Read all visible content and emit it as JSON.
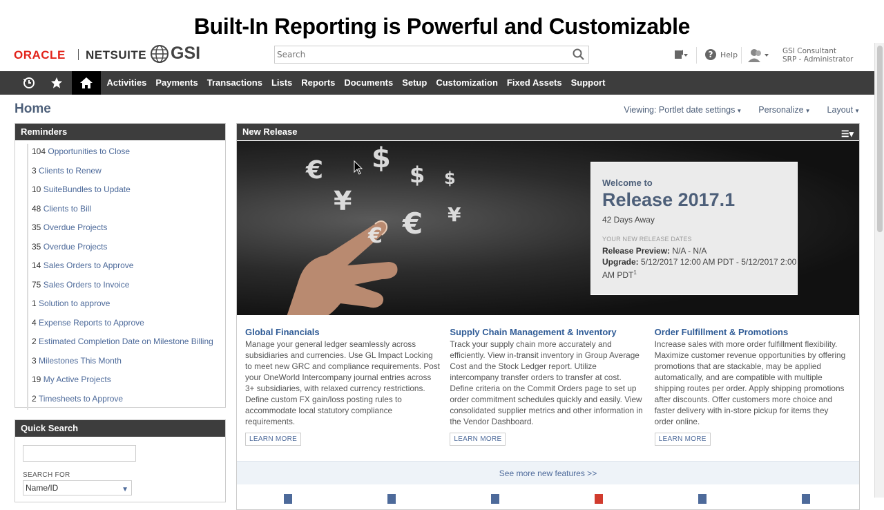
{
  "slide": {
    "title": "Built-In Reporting is Powerful and Customizable"
  },
  "header": {
    "logo_oracle": "ORACLE",
    "logo_netsuite": "NETSUITE",
    "logo_partner": "GSI",
    "search_placeholder": "Search",
    "help_label": "Help",
    "user_name": "GSI Consultant",
    "user_role": "SRP - Administrator"
  },
  "nav": {
    "items": [
      "Activities",
      "Payments",
      "Transactions",
      "Lists",
      "Reports",
      "Documents",
      "Setup",
      "Customization",
      "Fixed Assets",
      "Support"
    ]
  },
  "page": {
    "title": "Home",
    "actions": [
      "Viewing: Portlet date settings",
      "Personalize",
      "Layout"
    ]
  },
  "reminders": {
    "title": "Reminders",
    "items": [
      {
        "count": "104",
        "label": "Opportunities to Close"
      },
      {
        "count": "3",
        "label": "Clients to Renew"
      },
      {
        "count": "10",
        "label": "SuiteBundles to Update"
      },
      {
        "count": "48",
        "label": "Clients to Bill"
      },
      {
        "count": "35",
        "label": "Overdue Projects"
      },
      {
        "count": "35",
        "label": "Overdue Projects"
      },
      {
        "count": "14",
        "label": "Sales Orders to Approve"
      },
      {
        "count": "75",
        "label": "Sales Orders to Invoice"
      },
      {
        "count": "1",
        "label": "Solution to approve"
      },
      {
        "count": "4",
        "label": "Expense Reports to Approve"
      },
      {
        "count": "2",
        "label": "Estimated Completion Date on Milestone Billing"
      },
      {
        "count": "3",
        "label": "Milestones This Month"
      },
      {
        "count": "19",
        "label": "My Active Projects"
      },
      {
        "count": "2",
        "label": "Timesheets to Approve"
      }
    ]
  },
  "quick_search": {
    "title": "Quick Search",
    "search_for_label": "SEARCH FOR",
    "selected": "Name/ID"
  },
  "new_release": {
    "title": "New Release",
    "welcome": "Welcome to",
    "release": "Release 2017.1",
    "days_away": "42 Days Away",
    "dates_heading": "YOUR NEW RELEASE DATES",
    "preview_label": "Release Preview:",
    "preview_value": "N/A - N/A",
    "upgrade_label": "Upgrade:",
    "upgrade_value": "5/12/2017 12:00 AM PDT - 5/12/2017 2:00 AM PDT",
    "upgrade_sup": "1",
    "features": [
      {
        "title": "Global Financials",
        "text": "Manage your general ledger seamlessly across subsidiaries and currencies. Use GL Impact Locking to meet new GRC and compliance requirements. Post your OneWorld Intercompany journal entries across 3+ subsidiaries, with relaxed currency restrictions. Define custom FX gain/loss posting rules to accommodate local statutory compliance requirements.",
        "button": "LEARN MORE"
      },
      {
        "title": "Supply Chain Management & Inventory",
        "text": "Track your supply chain more accurately and efficiently. View in-transit inventory in Group Average Cost and the Stock Ledger report. Utilize intercompany transfer orders to transfer at cost. Define criteria on the Commit Orders page to set up order commitment schedules quickly and easily. View consolidated supplier metrics and other information in the Vendor Dashboard.",
        "button": "LEARN MORE"
      },
      {
        "title": "Order Fulfillment & Promotions",
        "text": "Increase sales with more order fulfillment flexibility. Maximize customer revenue opportunities by offering promotions that are stackable, may be applied automatically, and are compatible with multiple shipping routes per order.  Apply shipping promotions after discounts. Offer customers more choice and faster delivery with in-store pickup for items they order online.",
        "button": "LEARN MORE"
      }
    ],
    "see_more": "See more new features >>"
  }
}
